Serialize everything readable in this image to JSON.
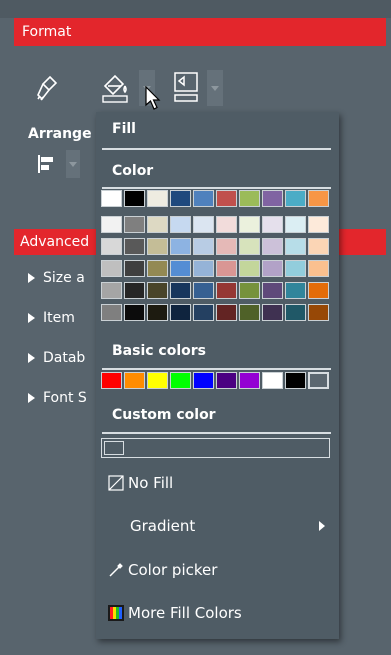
{
  "format_header": {
    "title": "Format"
  },
  "arrange": {
    "label": "Arrange"
  },
  "advanced": {
    "title": "Advanced",
    "items": [
      {
        "label": "Size a"
      },
      {
        "label": "Item"
      },
      {
        "label": "Datab"
      },
      {
        "label": "Font S"
      }
    ]
  },
  "menu": {
    "fill_title": "Fill",
    "color_title": "Color",
    "basic_colors_title": "Basic colors",
    "custom_color_title": "Custom color",
    "items": [
      {
        "label": "No Fill",
        "icon": "no-fill-icon"
      },
      {
        "label": "Gradient",
        "has_submenu": true
      },
      {
        "label": "Color picker",
        "icon": "eyedropper-icon"
      },
      {
        "label": "More Fill Colors",
        "icon": "palette-icon"
      }
    ],
    "theme_colors": [
      [
        "#ffffff",
        "#000000",
        "#eeece1",
        "#1f497d",
        "#4f81bd",
        "#c0504d",
        "#9bbb59",
        "#8064a2",
        "#4bacc6",
        "#f79646"
      ],
      [
        "#f2f2f2",
        "#7f7f7f",
        "#ddd9c3",
        "#c6d9f0",
        "#dbe5f1",
        "#f2dcdb",
        "#ebf1dd",
        "#e5e0ec",
        "#dbeef3",
        "#fdeada"
      ],
      [
        "#d8d8d8",
        "#595959",
        "#c4bd97",
        "#8db3e2",
        "#b8cce4",
        "#e5b9b7",
        "#d7e3bc",
        "#ccc1d9",
        "#b7dde8",
        "#fbd5b5"
      ],
      [
        "#bfbfbf",
        "#3f3f3f",
        "#938953",
        "#548dd4",
        "#95b3d7",
        "#d99694",
        "#c3d69b",
        "#b2a2c7",
        "#92cddc",
        "#fac08f"
      ],
      [
        "#a5a5a5",
        "#262626",
        "#494429",
        "#17365d",
        "#366092",
        "#953734",
        "#76923c",
        "#5f497a",
        "#31859b",
        "#e36c09"
      ],
      [
        "#7f7f7f",
        "#0c0c0c",
        "#1d1b10",
        "#0f243e",
        "#244061",
        "#632423",
        "#4f6128",
        "#3f3151",
        "#205867",
        "#974806"
      ]
    ],
    "basic_colors": [
      "#ff0000",
      "#ff8c00",
      "#ffff00",
      "#00ff00",
      "#0000ff",
      "#4b0082",
      "#9400d3",
      "#ffffff",
      "#000000",
      "#5b6770"
    ]
  }
}
